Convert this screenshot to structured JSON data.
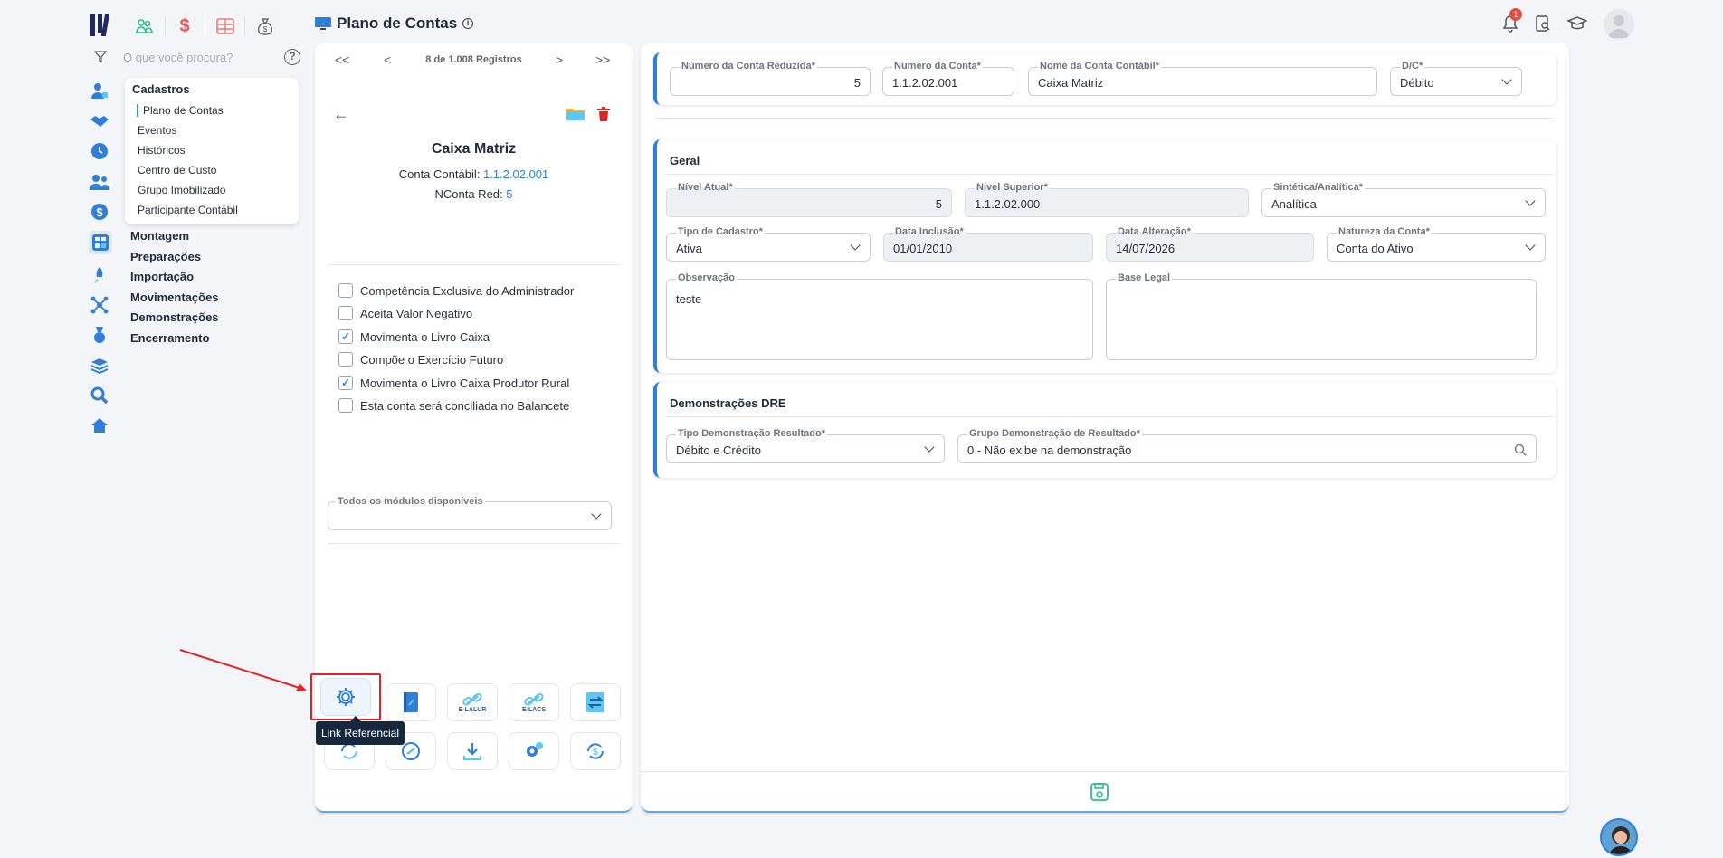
{
  "header": {
    "title": "Plano de Contas",
    "notification_count": "1",
    "modules": [
      "people-group-icon",
      "dollar-icon",
      "grid-icon",
      "money-bag-icon"
    ]
  },
  "search": {
    "placeholder": "O que você procura?"
  },
  "sidebar": {
    "submenu": {
      "title": "Cadastros",
      "items": [
        "Plano de Contas",
        "Eventos",
        "Históricos",
        "Centro de Custo",
        "Grupo Imobilizado",
        "Participante Contábil"
      ]
    },
    "items": [
      "Montagem",
      "Preparações",
      "Importação",
      "Movimentações",
      "Demonstrações",
      "Encerramento"
    ]
  },
  "record": {
    "pager_text": "8 de 1.008 Registros",
    "name": "Caixa Matriz",
    "conta_label": "Conta Contábil:",
    "conta_value": "1.1.2.02.001",
    "nconta_label": "NConta Red:",
    "nconta_value": "5",
    "checkboxes": [
      {
        "label": "Competência Exclusiva do Administrador",
        "checked": false
      },
      {
        "label": "Aceita Valor Negativo",
        "checked": false
      },
      {
        "label": "Movimenta o Livro Caixa",
        "checked": true
      },
      {
        "label": "Compõe o Exercício Futuro",
        "checked": false
      },
      {
        "label": "Movimenta o Livro Caixa Produtor Rural",
        "checked": true
      },
      {
        "label": "Esta conta será conciliada no Balancete",
        "checked": false
      }
    ],
    "modules_label": "Todos os módulos disponíveis",
    "tooltip": "Link Referencial",
    "tool_labels": {
      "elalur": "E-LALUR",
      "elacs": "E-LACS"
    }
  },
  "form": {
    "top": {
      "numero_reduzida_label": "Número da Conta Reduzida*",
      "numero_reduzida": "5",
      "numero_conta_label": "Numero da Conta*",
      "numero_conta": "1.1.2.02.001",
      "nome_label": "Nome da Conta Contábil*",
      "nome": "Caixa Matriz",
      "dc_label": "D/C*",
      "dc": "Débito"
    },
    "geral": {
      "title": "Geral",
      "nivel_atual_label": "Nível Atual*",
      "nivel_atual": "5",
      "nivel_superior_label": "Nivel Superior*",
      "nivel_superior": "1.1.2.02.000",
      "sintetica_label": "Sintética/Analítica*",
      "sintetica": "Analítica",
      "tipo_cadastro_label": "Tipo de Cadastro*",
      "tipo_cadastro": "Ativa",
      "data_inclusao_label": "Data Inclusão*",
      "data_inclusao": "01/01/2010",
      "data_alteracao_label": "Data Alteração*",
      "data_alteracao": "14/07/2026",
      "natureza_label": "Natureza da Conta*",
      "natureza": "Conta do Ativo",
      "observacao_label": "Observação",
      "observacao": "teste",
      "base_legal_label": "Base Legal",
      "base_legal": ""
    },
    "dre": {
      "title": "Demonstrações DRE",
      "tipo_label": "Tipo Demonstração Resultado*",
      "tipo": "Débito e Crédito",
      "grupo_label": "Grupo Demonstração de Resultado*",
      "grupo": "0 - Não exibe na demonstração"
    }
  },
  "colors": {
    "accent": "#2f7ed8",
    "highlight": "#d62828",
    "tooltip_bg": "#17273d"
  }
}
